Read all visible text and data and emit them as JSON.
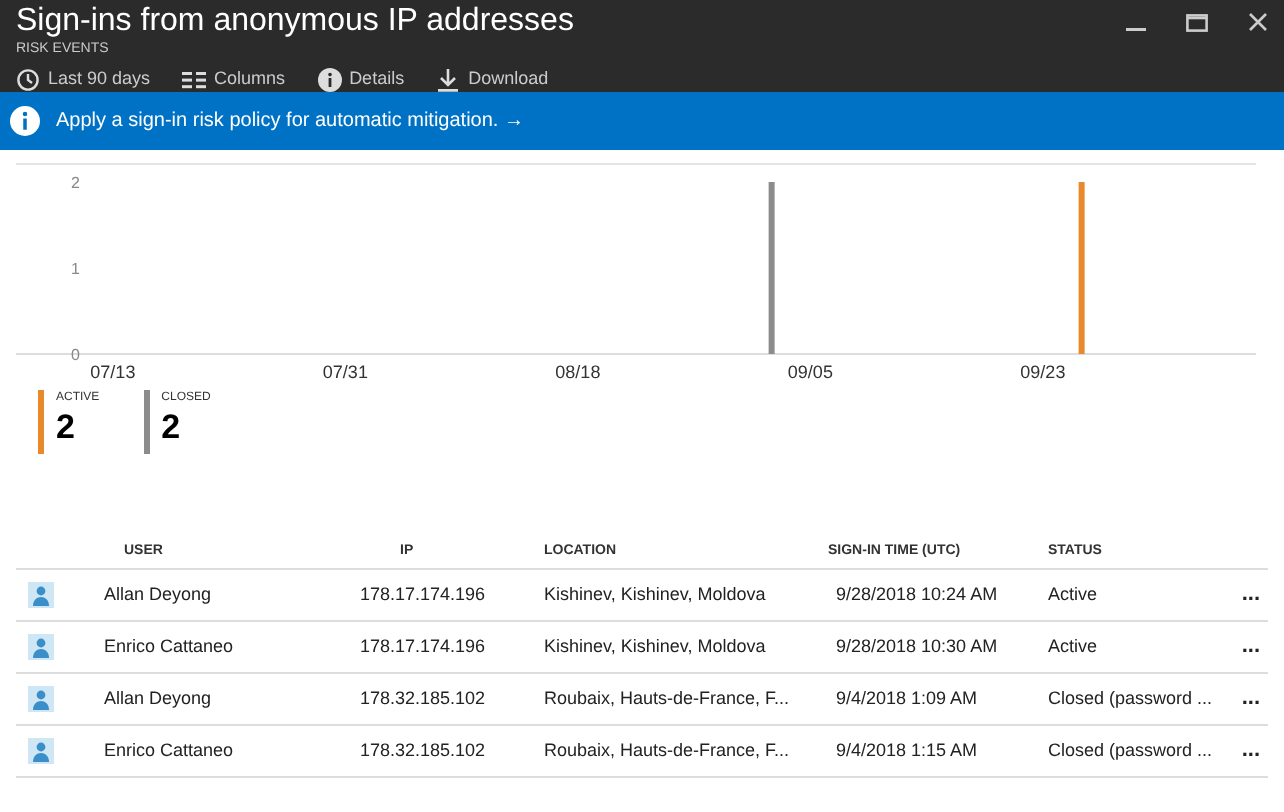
{
  "window": {
    "title": "Sign-ins from anonymous IP addresses",
    "subtitle": "RISK EVENTS"
  },
  "toolbar": [
    {
      "kind": "clock",
      "label": "Last 90 days"
    },
    {
      "kind": "columns",
      "label": "Columns"
    },
    {
      "kind": "info",
      "label": "Details"
    },
    {
      "kind": "download",
      "label": "Download"
    }
  ],
  "banner": {
    "text": "Apply a sign-in risk policy for automatic mitigation.",
    "arrow": "→"
  },
  "chart": {
    "chart_data": {
      "type": "bar",
      "stacked": true,
      "ylim": [
        0,
        2
      ],
      "yticks": [
        0,
        1,
        2
      ],
      "categories": [
        null,
        null,
        "07/13",
        null,
        null,
        null,
        null,
        null,
        "07/31",
        null,
        null,
        null,
        null,
        null,
        "08/18",
        null,
        null,
        null,
        null,
        null,
        "09/05",
        null,
        null,
        null,
        null,
        null,
        "09/23",
        null,
        null,
        null,
        null,
        null
      ],
      "series": [
        {
          "name": "ACTIVE",
          "color": "#e8892b",
          "values": [
            null,
            null,
            null,
            null,
            null,
            null,
            null,
            null,
            null,
            null,
            null,
            null,
            null,
            null,
            null,
            null,
            null,
            null,
            null,
            null,
            null,
            null,
            null,
            null,
            null,
            null,
            null,
            2,
            null,
            null,
            null,
            null
          ]
        },
        {
          "name": "CLOSED",
          "color": "#8c8c8c",
          "values": [
            null,
            null,
            null,
            null,
            null,
            null,
            null,
            null,
            null,
            null,
            null,
            null,
            null,
            null,
            null,
            null,
            null,
            null,
            null,
            2,
            null,
            null,
            null,
            null,
            null,
            null,
            null,
            null,
            null,
            null,
            null,
            null
          ]
        }
      ]
    }
  },
  "summary": [
    {
      "count": "2"
    },
    {
      "count": "2"
    }
  ],
  "table": {
    "columns": [
      "USER",
      "IP",
      "LOCATION",
      "SIGN-IN TIME (UTC)",
      "STATUS"
    ],
    "rows": [
      {
        "user": "Allan Deyong",
        "ip": "178.17.174.196",
        "location": "Kishinev, Kishinev, Moldova",
        "time": "9/28/2018 10:24 AM",
        "status": "Active",
        "more": "..."
      },
      {
        "user": "Enrico Cattaneo",
        "ip": "178.17.174.196",
        "location": "Kishinev, Kishinev, Moldova",
        "time": "9/28/2018 10:30 AM",
        "status": "Active",
        "more": "..."
      },
      {
        "user": "Allan Deyong",
        "ip": "178.32.185.102",
        "location": "Roubaix, Hauts-de-France, F...",
        "time": "9/4/2018 1:09 AM",
        "status": "Closed (password ...",
        "more": "..."
      },
      {
        "user": "Enrico Cattaneo",
        "ip": "178.32.185.102",
        "location": "Roubaix, Hauts-de-France, F...",
        "time": "9/4/2018 1:15 AM",
        "status": "Closed (password ...",
        "more": "..."
      }
    ]
  }
}
